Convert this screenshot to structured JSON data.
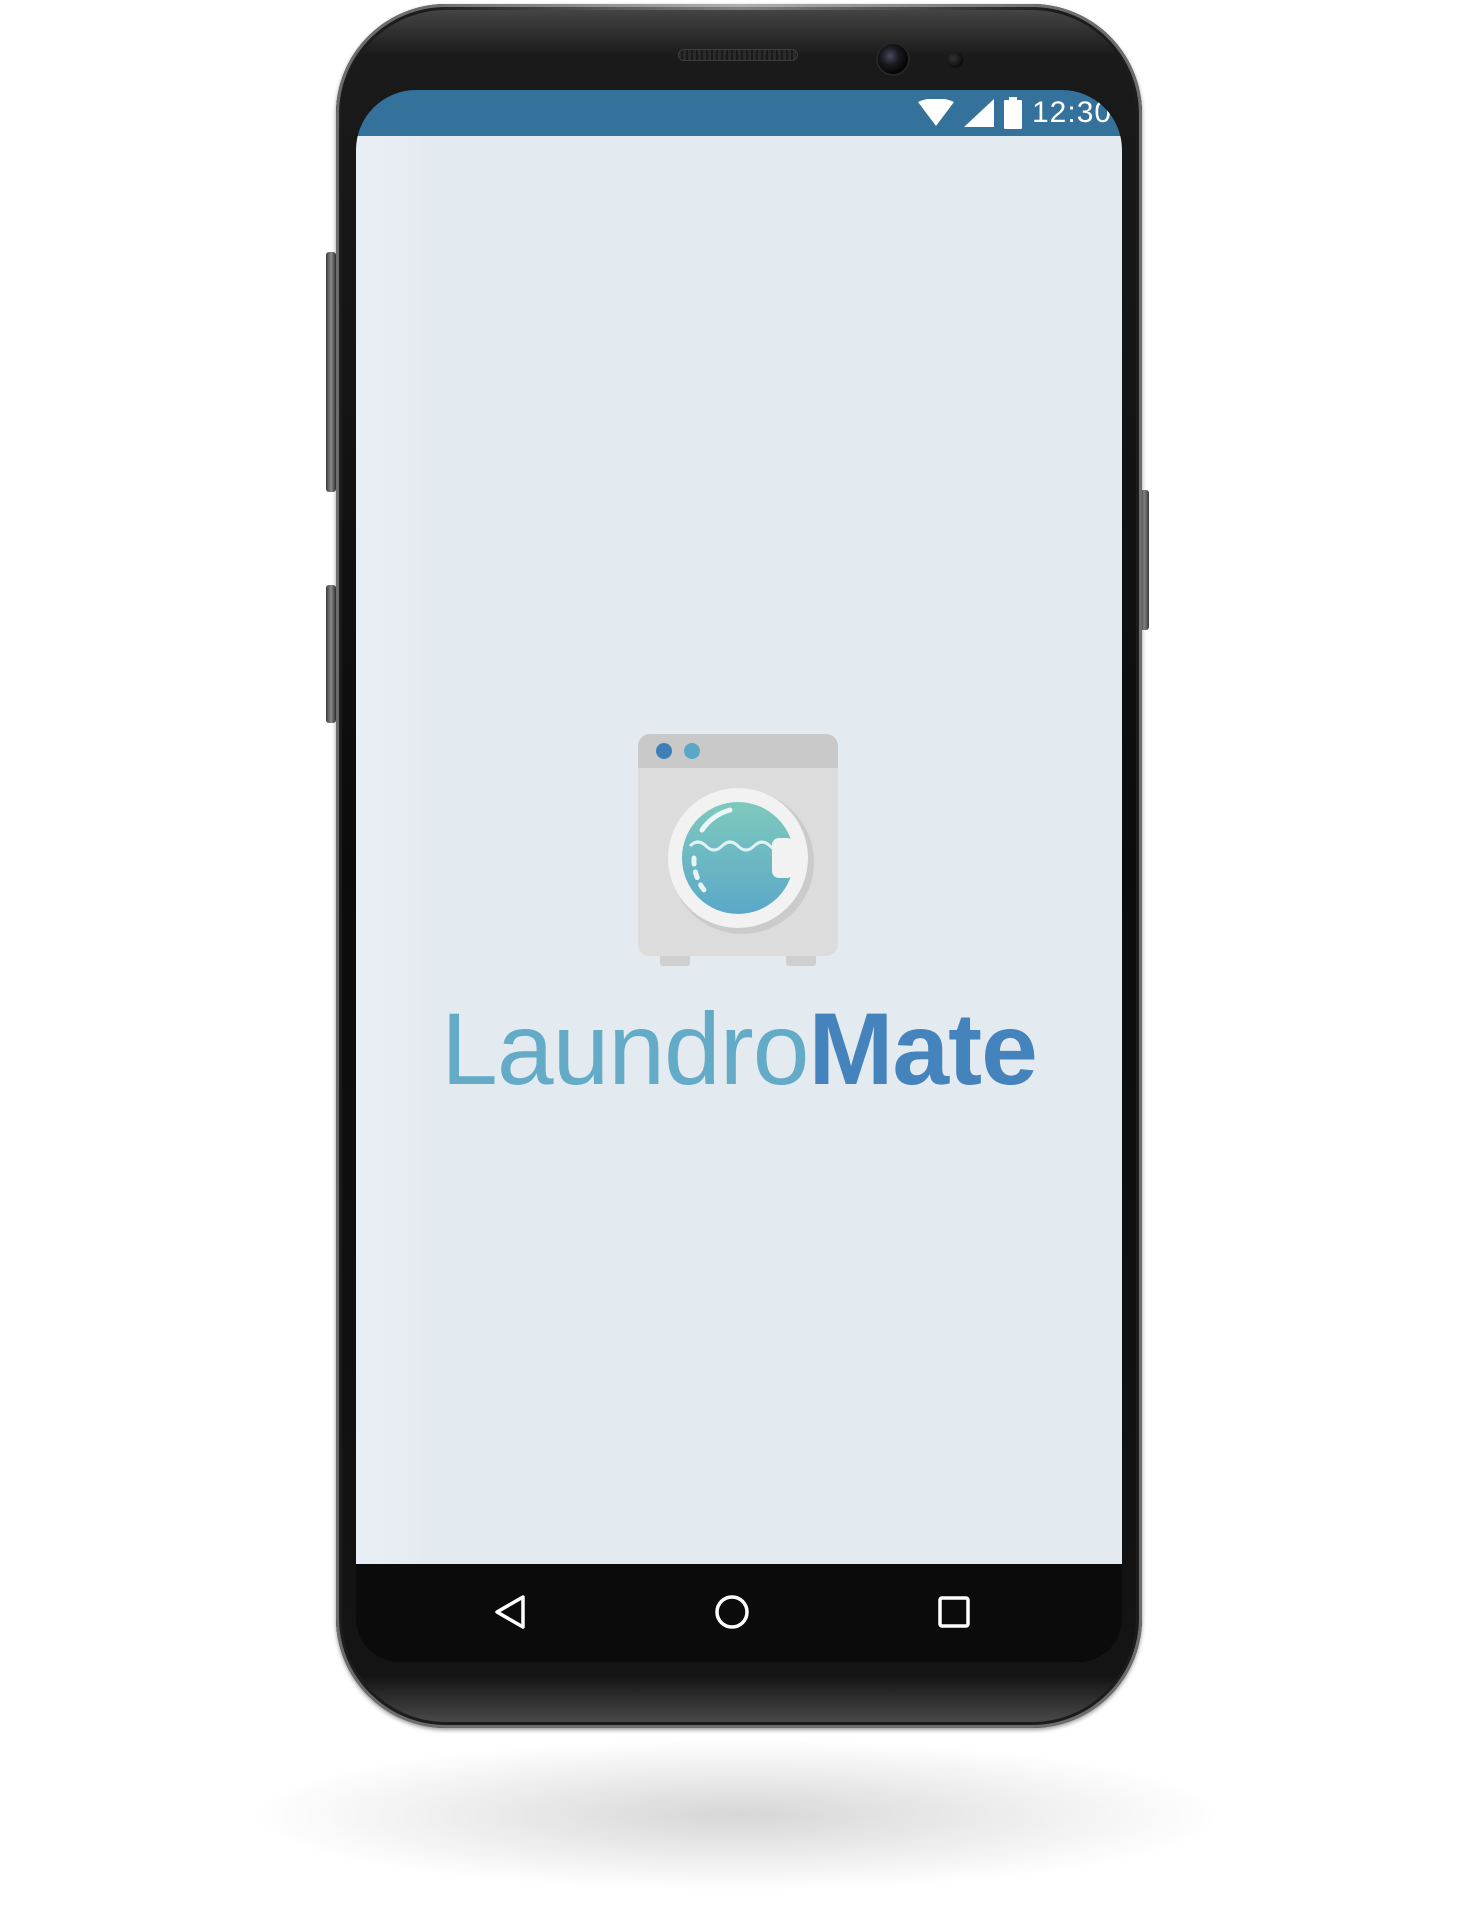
{
  "status_bar": {
    "time": "12:30",
    "color": "#34719b",
    "icons": [
      "wifi-icon",
      "cellular-signal-icon",
      "battery-icon"
    ]
  },
  "splash": {
    "logo_icon": "washing-machine-icon",
    "brand_part1": "Laundro",
    "brand_part2": "Mate",
    "brand_part1_color": "#63abc6",
    "brand_part2_color": "#4483bc",
    "background_color": "#e3eaf0"
  },
  "nav_bar": {
    "buttons": [
      "back-icon",
      "home-icon",
      "recents-icon"
    ]
  }
}
